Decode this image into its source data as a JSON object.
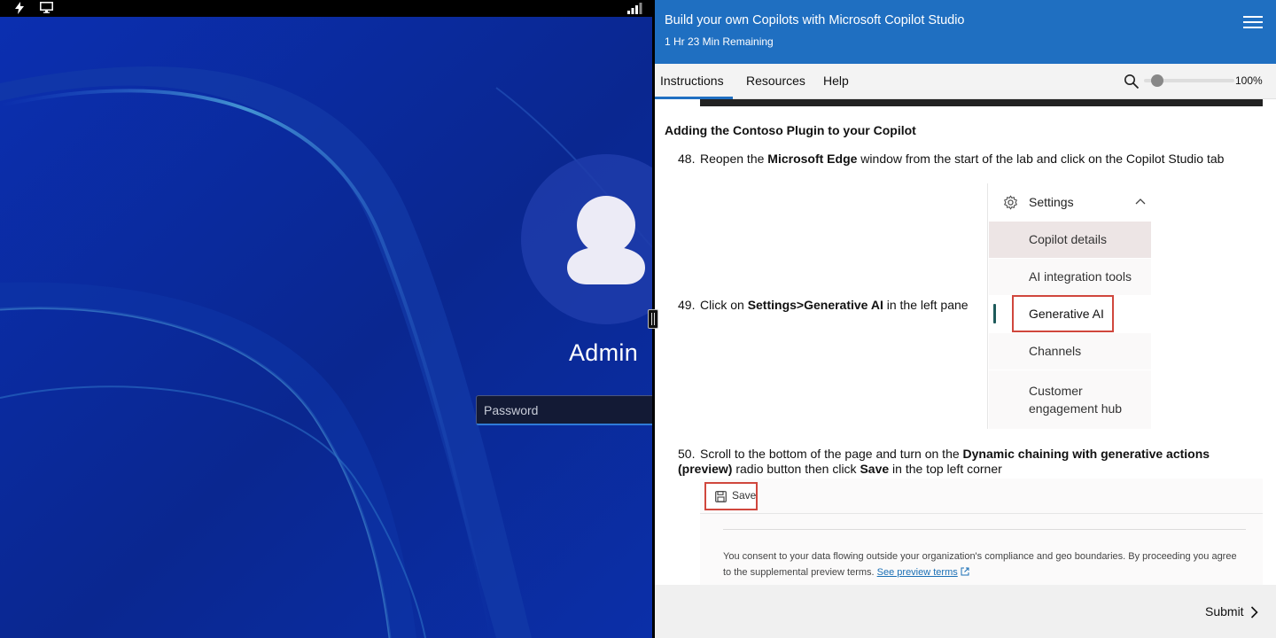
{
  "vm": {
    "username": "Admin",
    "password_placeholder": "Password",
    "topbar_icons": [
      "power-icon",
      "monitor-icon",
      "signal-icon"
    ]
  },
  "lab": {
    "title": "Build your own Copilots with Microsoft Copilot Studio",
    "time_remaining": "1 Hr 23 Min Remaining",
    "tabs": [
      "Instructions",
      "Resources",
      "Help"
    ],
    "active_tab": "Instructions",
    "zoom": "100%",
    "zoom_level_fraction": 0.15,
    "accent_color": "#1f6fc1"
  },
  "content": {
    "section_heading": "Adding the Contoso Plugin to your Copilot",
    "step48": {
      "num": "48.",
      "pre": "Reopen the ",
      "bold": "Microsoft Edge",
      "post": " window from the start of the lab and click on the Copilot Studio tab"
    },
    "step49": {
      "num": "49.",
      "pre": "Click on ",
      "bold": "Settings>Generative AI",
      "post": " in the left pane"
    },
    "step50": {
      "num": "50.",
      "pre": "Scroll to the bottom of the page and turn on the ",
      "bold1": "Dynamic chaining with generative actions (preview)",
      "mid": " radio button then click ",
      "bold2": "Save",
      "post": " in the top left corner"
    },
    "settings_panel": {
      "header": "Settings",
      "items": [
        "Copilot details",
        "AI integration tools",
        "Generative AI",
        "Channels",
        "Customer engagement hub"
      ]
    },
    "save_label": "Save",
    "consent_text": "You consent to your data flowing outside your organization's compliance and geo boundaries. By proceeding you agree to the supplemental preview terms.",
    "consent_link": "See preview terms"
  },
  "footer": {
    "submit_label": "Submit"
  }
}
